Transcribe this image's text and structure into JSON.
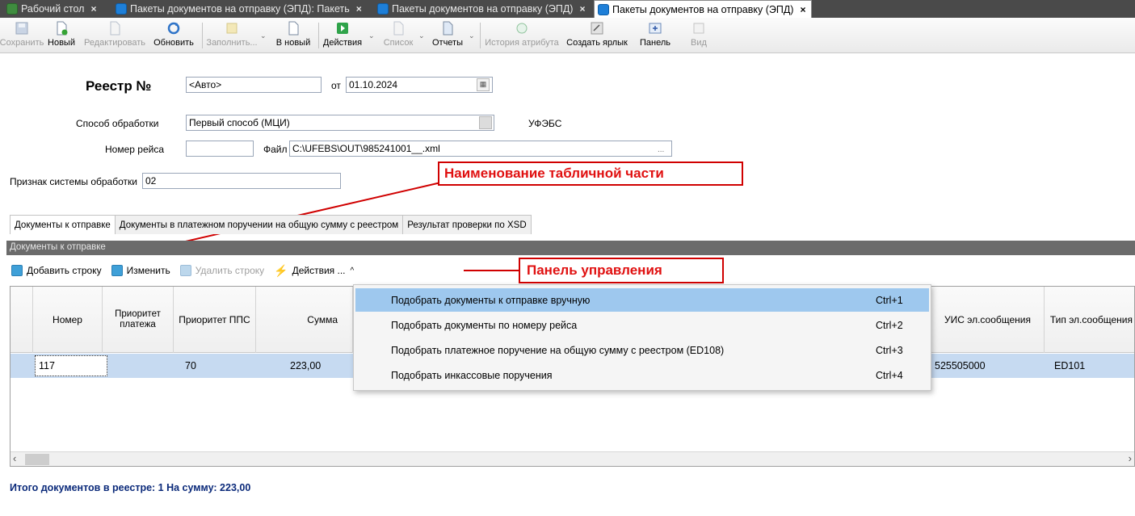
{
  "tabs": [
    {
      "label": "Рабочий стол",
      "icon": "desktop-icon"
    },
    {
      "label": "Пакеты документов на отправку  (ЭПД): Пакеть",
      "icon": "document-icon"
    },
    {
      "label": "Пакеты документов на отправку  (ЭПД)",
      "icon": "document-icon"
    },
    {
      "label": "Пакеты документов на отправку  (ЭПД)",
      "icon": "document-icon",
      "active": true
    }
  ],
  "tab_close": "×",
  "toolbar": {
    "save": "Сохранить",
    "new": "Новый",
    "edit": "Редактировать",
    "refresh": "Обновить",
    "fill": "Заполнить...",
    "to_new": "В новый",
    "actions": "Действия",
    "list": "Список",
    "reports": "Отчеты",
    "attr_history": "История атрибута",
    "create_shortcut": "Создать ярлык",
    "panel": "Панель",
    "view": "Вид"
  },
  "form": {
    "registry_label": "Реестр №",
    "registry_value": "<Авто>",
    "from_label": "от",
    "date_value": "01.10.2024",
    "method_label": "Способ обработки",
    "method_value": "Первый способ (МЦИ)",
    "ufebs_label": "УФЭБС",
    "flight_label": "Номер рейса",
    "flight_value": "",
    "file_label": "Файл",
    "file_value": "C:\\UFEBS\\OUT\\985241001__.xml",
    "file_btn": "...",
    "system_label": "Признак системы обработки",
    "system_value": "02"
  },
  "annotations": {
    "table_part": "Наименование табличной части",
    "control_panel": "Панель управления"
  },
  "section_tabs": [
    "Документы к отправке",
    "Документы в платежном поручении на общую сумму с реестром",
    "Результат проверки по XSD"
  ],
  "section_title": "Документы к отправке",
  "action_bar": {
    "add_row": "Добавить строку",
    "edit": "Изменить",
    "delete_row": "Удалить строку",
    "actions": "Действия ...",
    "caret": "^"
  },
  "grid": {
    "columns": [
      "Номер",
      "Приоритет платежа",
      "Приоритет ППС",
      "Сумма",
      "УИС эл.сообщения",
      "Тип эл.сообщения"
    ],
    "rows": [
      {
        "number": "117",
        "priority": "",
        "pps": "70",
        "sum": "223,00",
        "uis": "525505000",
        "type": "ED101"
      }
    ]
  },
  "menu": [
    {
      "label": "Подобрать документы к отправке вручную",
      "shortcut": "Ctrl+1"
    },
    {
      "label": "Подобрать документы по номеру рейса",
      "shortcut": "Ctrl+2"
    },
    {
      "label": "Подобрать платежное поручение на общую сумму с реестром (ED108)",
      "shortcut": "Ctrl+3"
    },
    {
      "label": "Подобрать инкассовые поручения",
      "shortcut": "Ctrl+4"
    }
  ],
  "footer": "Итого документов в реестре: 1  На сумму: 223,00",
  "colors": {
    "accent": "#1e7fd8",
    "selection": "#c6daf1",
    "menu_selection": "#9ec8ee",
    "annotation": "#e01010"
  }
}
